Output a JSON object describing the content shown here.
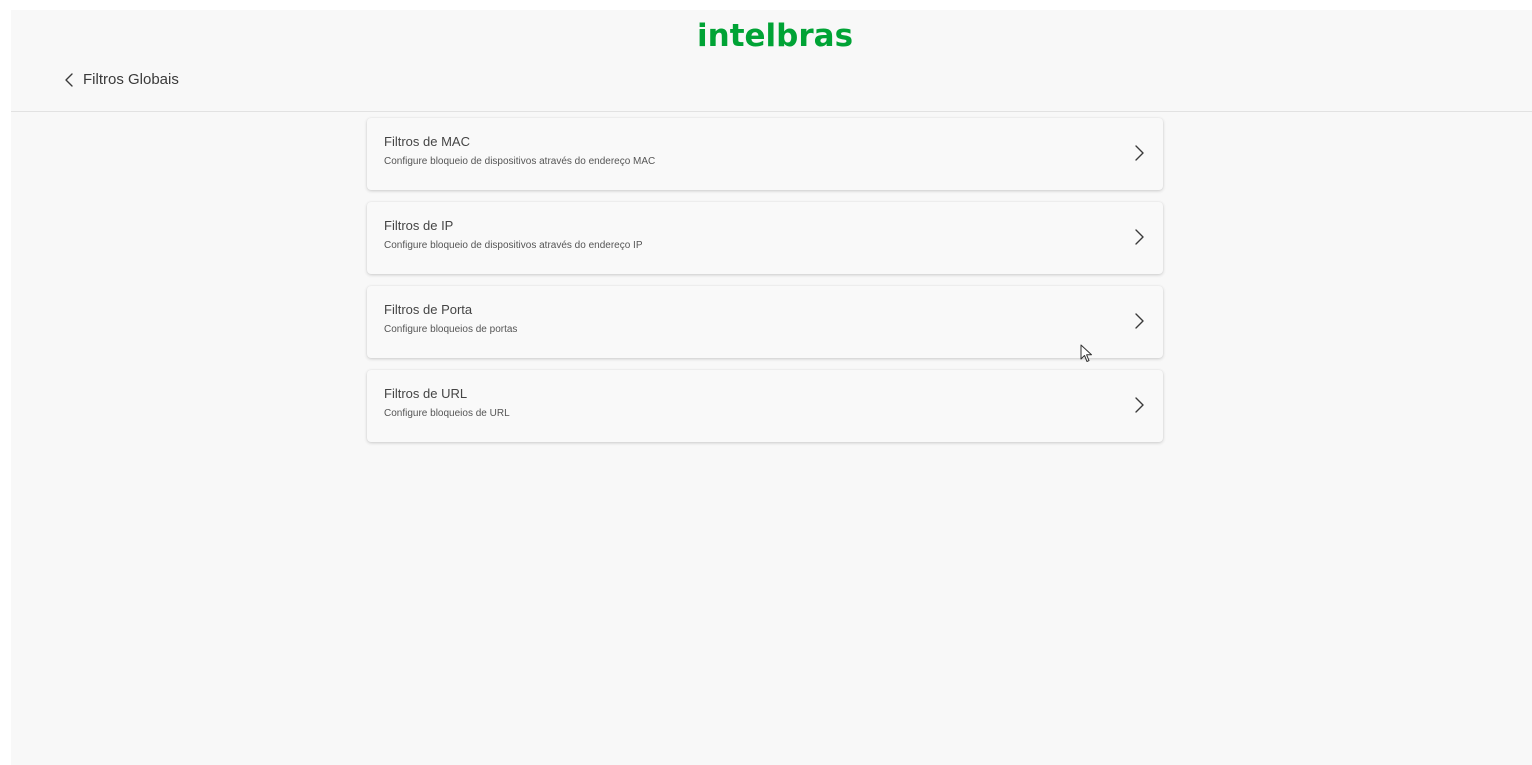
{
  "header": {
    "logo_text": "intelbras",
    "back_label": "Filtros Globais",
    "brand_color": "#00a335"
  },
  "filters": [
    {
      "title": "Filtros de MAC",
      "description": "Configure bloqueio de dispositivos através do endereço MAC"
    },
    {
      "title": "Filtros de IP",
      "description": "Configure bloqueio de dispositivos através do endereço IP"
    },
    {
      "title": "Filtros de Porta",
      "description": "Configure bloqueios de portas"
    },
    {
      "title": "Filtros de URL",
      "description": "Configure bloqueios de URL"
    }
  ],
  "icons": {
    "back": "chevron-left-icon",
    "item": "chevron-right-icon",
    "cursor": "mouse-pointer-icon"
  }
}
